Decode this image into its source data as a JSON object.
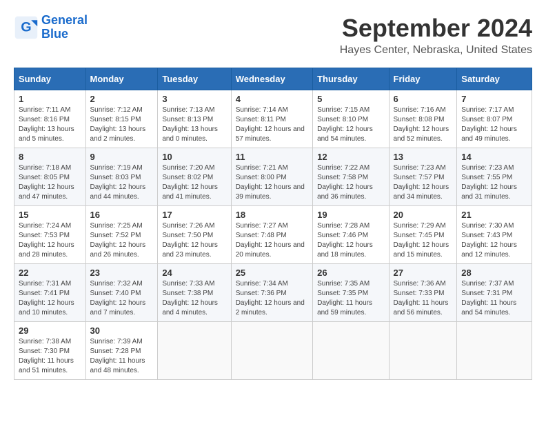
{
  "header": {
    "logo_line1": "General",
    "logo_line2": "Blue",
    "month": "September 2024",
    "location": "Hayes Center, Nebraska, United States"
  },
  "weekdays": [
    "Sunday",
    "Monday",
    "Tuesday",
    "Wednesday",
    "Thursday",
    "Friday",
    "Saturday"
  ],
  "weeks": [
    [
      {
        "day": "1",
        "sunrise": "7:11 AM",
        "sunset": "8:16 PM",
        "daylight": "13 hours and 5 minutes."
      },
      {
        "day": "2",
        "sunrise": "7:12 AM",
        "sunset": "8:15 PM",
        "daylight": "13 hours and 2 minutes."
      },
      {
        "day": "3",
        "sunrise": "7:13 AM",
        "sunset": "8:13 PM",
        "daylight": "13 hours and 0 minutes."
      },
      {
        "day": "4",
        "sunrise": "7:14 AM",
        "sunset": "8:11 PM",
        "daylight": "12 hours and 57 minutes."
      },
      {
        "day": "5",
        "sunrise": "7:15 AM",
        "sunset": "8:10 PM",
        "daylight": "12 hours and 54 minutes."
      },
      {
        "day": "6",
        "sunrise": "7:16 AM",
        "sunset": "8:08 PM",
        "daylight": "12 hours and 52 minutes."
      },
      {
        "day": "7",
        "sunrise": "7:17 AM",
        "sunset": "8:07 PM",
        "daylight": "12 hours and 49 minutes."
      }
    ],
    [
      {
        "day": "8",
        "sunrise": "7:18 AM",
        "sunset": "8:05 PM",
        "daylight": "12 hours and 47 minutes."
      },
      {
        "day": "9",
        "sunrise": "7:19 AM",
        "sunset": "8:03 PM",
        "daylight": "12 hours and 44 minutes."
      },
      {
        "day": "10",
        "sunrise": "7:20 AM",
        "sunset": "8:02 PM",
        "daylight": "12 hours and 41 minutes."
      },
      {
        "day": "11",
        "sunrise": "7:21 AM",
        "sunset": "8:00 PM",
        "daylight": "12 hours and 39 minutes."
      },
      {
        "day": "12",
        "sunrise": "7:22 AM",
        "sunset": "7:58 PM",
        "daylight": "12 hours and 36 minutes."
      },
      {
        "day": "13",
        "sunrise": "7:23 AM",
        "sunset": "7:57 PM",
        "daylight": "12 hours and 34 minutes."
      },
      {
        "day": "14",
        "sunrise": "7:23 AM",
        "sunset": "7:55 PM",
        "daylight": "12 hours and 31 minutes."
      }
    ],
    [
      {
        "day": "15",
        "sunrise": "7:24 AM",
        "sunset": "7:53 PM",
        "daylight": "12 hours and 28 minutes."
      },
      {
        "day": "16",
        "sunrise": "7:25 AM",
        "sunset": "7:52 PM",
        "daylight": "12 hours and 26 minutes."
      },
      {
        "day": "17",
        "sunrise": "7:26 AM",
        "sunset": "7:50 PM",
        "daylight": "12 hours and 23 minutes."
      },
      {
        "day": "18",
        "sunrise": "7:27 AM",
        "sunset": "7:48 PM",
        "daylight": "12 hours and 20 minutes."
      },
      {
        "day": "19",
        "sunrise": "7:28 AM",
        "sunset": "7:46 PM",
        "daylight": "12 hours and 18 minutes."
      },
      {
        "day": "20",
        "sunrise": "7:29 AM",
        "sunset": "7:45 PM",
        "daylight": "12 hours and 15 minutes."
      },
      {
        "day": "21",
        "sunrise": "7:30 AM",
        "sunset": "7:43 PM",
        "daylight": "12 hours and 12 minutes."
      }
    ],
    [
      {
        "day": "22",
        "sunrise": "7:31 AM",
        "sunset": "7:41 PM",
        "daylight": "12 hours and 10 minutes."
      },
      {
        "day": "23",
        "sunrise": "7:32 AM",
        "sunset": "7:40 PM",
        "daylight": "12 hours and 7 minutes."
      },
      {
        "day": "24",
        "sunrise": "7:33 AM",
        "sunset": "7:38 PM",
        "daylight": "12 hours and 4 minutes."
      },
      {
        "day": "25",
        "sunrise": "7:34 AM",
        "sunset": "7:36 PM",
        "daylight": "12 hours and 2 minutes."
      },
      {
        "day": "26",
        "sunrise": "7:35 AM",
        "sunset": "7:35 PM",
        "daylight": "11 hours and 59 minutes."
      },
      {
        "day": "27",
        "sunrise": "7:36 AM",
        "sunset": "7:33 PM",
        "daylight": "11 hours and 56 minutes."
      },
      {
        "day": "28",
        "sunrise": "7:37 AM",
        "sunset": "7:31 PM",
        "daylight": "11 hours and 54 minutes."
      }
    ],
    [
      {
        "day": "29",
        "sunrise": "7:38 AM",
        "sunset": "7:30 PM",
        "daylight": "11 hours and 51 minutes."
      },
      {
        "day": "30",
        "sunrise": "7:39 AM",
        "sunset": "7:28 PM",
        "daylight": "11 hours and 48 minutes."
      },
      null,
      null,
      null,
      null,
      null
    ]
  ]
}
